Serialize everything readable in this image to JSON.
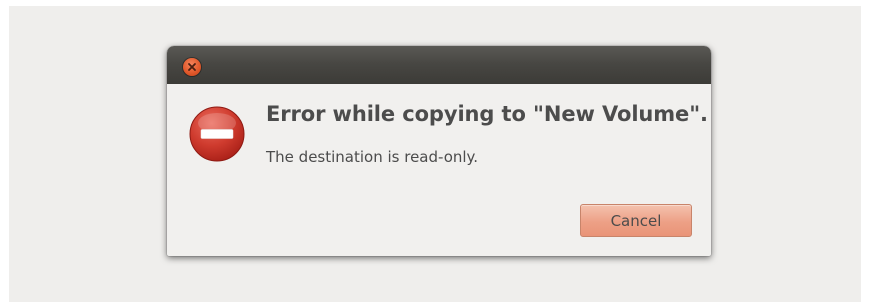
{
  "dialog": {
    "title": "Error while copying to \"New Volume\".",
    "message": "The destination is read-only.",
    "cancel_label": "Cancel"
  },
  "icons": {
    "close": "close-icon",
    "error": "error-icon"
  },
  "colors": {
    "titlebar": "#3c3b37",
    "close_button": "#e25a2c",
    "error_icon": "#c9302c",
    "cancel_button": "#eda086",
    "text": "#4c4c4c"
  }
}
